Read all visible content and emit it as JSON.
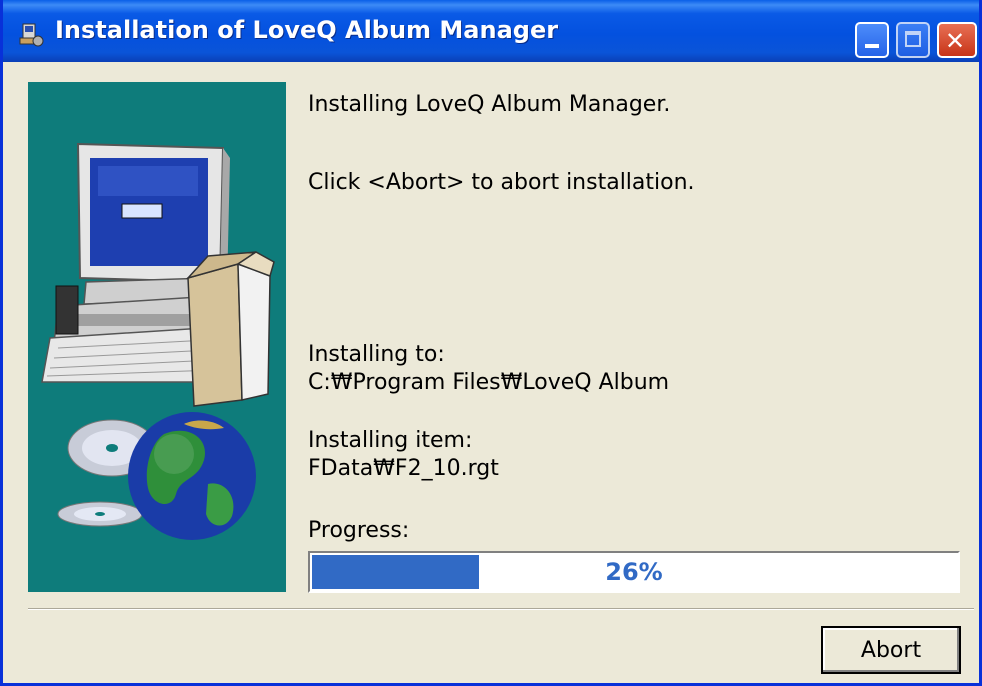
{
  "window": {
    "title": "Installation of LoveQ Album Manager",
    "app_icon": "installer-icon",
    "controls": {
      "minimize": "minimize-icon",
      "maximize": "maximize-icon",
      "close": "close-icon"
    }
  },
  "side_panel": {
    "illustration": "computer-box-cd-globe-illustration",
    "background_color": "#0e7c7b"
  },
  "messages": {
    "installing": "Installing LoveQ Album Manager.",
    "abort_hint": "Click <Abort> to abort installation.",
    "installing_to_label": "Installing to:",
    "installing_to_path": "C:₩Program Files₩LoveQ Album",
    "installing_item_label": "Installing item:",
    "installing_item_value": "FData₩F2_10.rgt",
    "progress_label": "Progress:"
  },
  "progress": {
    "percent": 26,
    "text": "26%"
  },
  "buttons": {
    "abort": "Abort"
  },
  "colors": {
    "titlebar": "#0a54d8",
    "dialog_bg": "#ece9d8",
    "progress_fill": "#316ac5",
    "close_button": "#d0462a"
  }
}
